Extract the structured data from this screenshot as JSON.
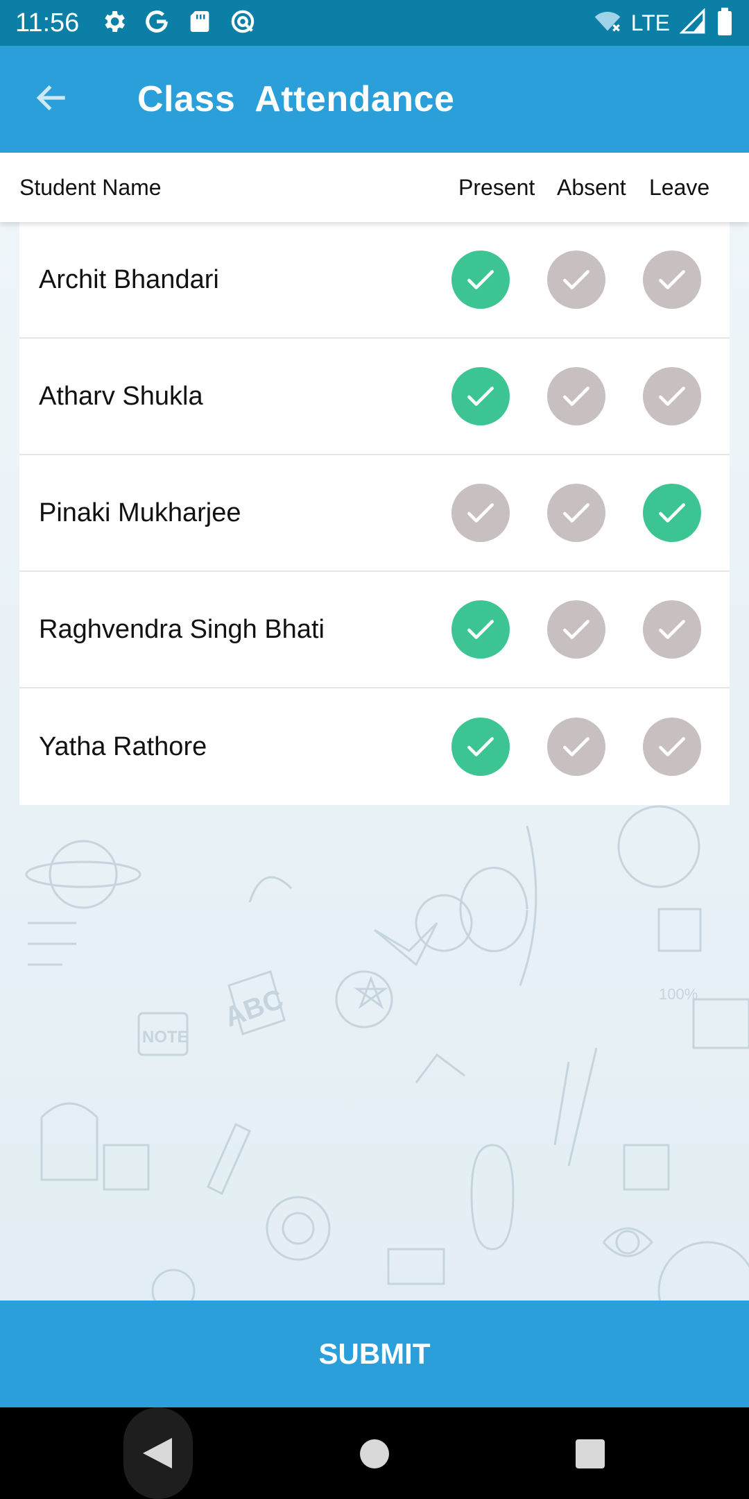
{
  "status": {
    "time": "11:56",
    "network": "LTE"
  },
  "app_bar": {
    "title": "Class  Attendance"
  },
  "header": {
    "name": "Student Name",
    "present": "Present",
    "absent": "Absent",
    "leave": "Leave"
  },
  "students": [
    {
      "name": "Archit Bhandari",
      "status": "present"
    },
    {
      "name": "Atharv Shukla",
      "status": "present"
    },
    {
      "name": "Pinaki Mukharjee",
      "status": "leave"
    },
    {
      "name": "Raghvendra Singh Bhati",
      "status": "present"
    },
    {
      "name": "Yatha Rathore",
      "status": "present"
    }
  ],
  "submit_label": "SUBMIT",
  "colors": {
    "app_bar": "#2b9fd9",
    "status_bar": "#0b7fa6",
    "selected": "#3cc493",
    "unselected": "#c7bfc0"
  }
}
